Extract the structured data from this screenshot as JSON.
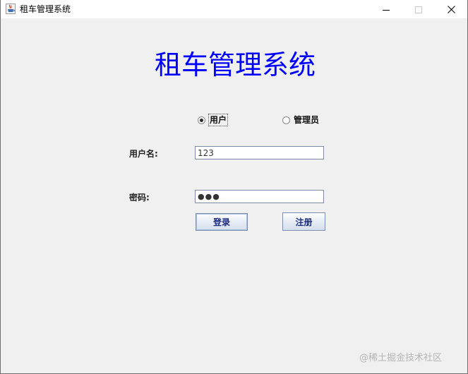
{
  "window": {
    "title": "租车管理系统",
    "controls": {
      "minimize_icon": "minimize-icon",
      "maximize_icon": "maximize-icon",
      "close_icon": "close-icon"
    }
  },
  "main": {
    "heading": "租车管理系统",
    "heading_color": "#0000ff",
    "role_options": [
      {
        "label": "用户",
        "selected": true
      },
      {
        "label": "管理员",
        "selected": false
      }
    ],
    "username": {
      "label": "用户名:",
      "value": "123"
    },
    "password": {
      "label": "密码:",
      "value": "●●●"
    },
    "buttons": {
      "login": "登录",
      "register": "注册"
    }
  },
  "watermark": "@稀土掘金技术社区"
}
